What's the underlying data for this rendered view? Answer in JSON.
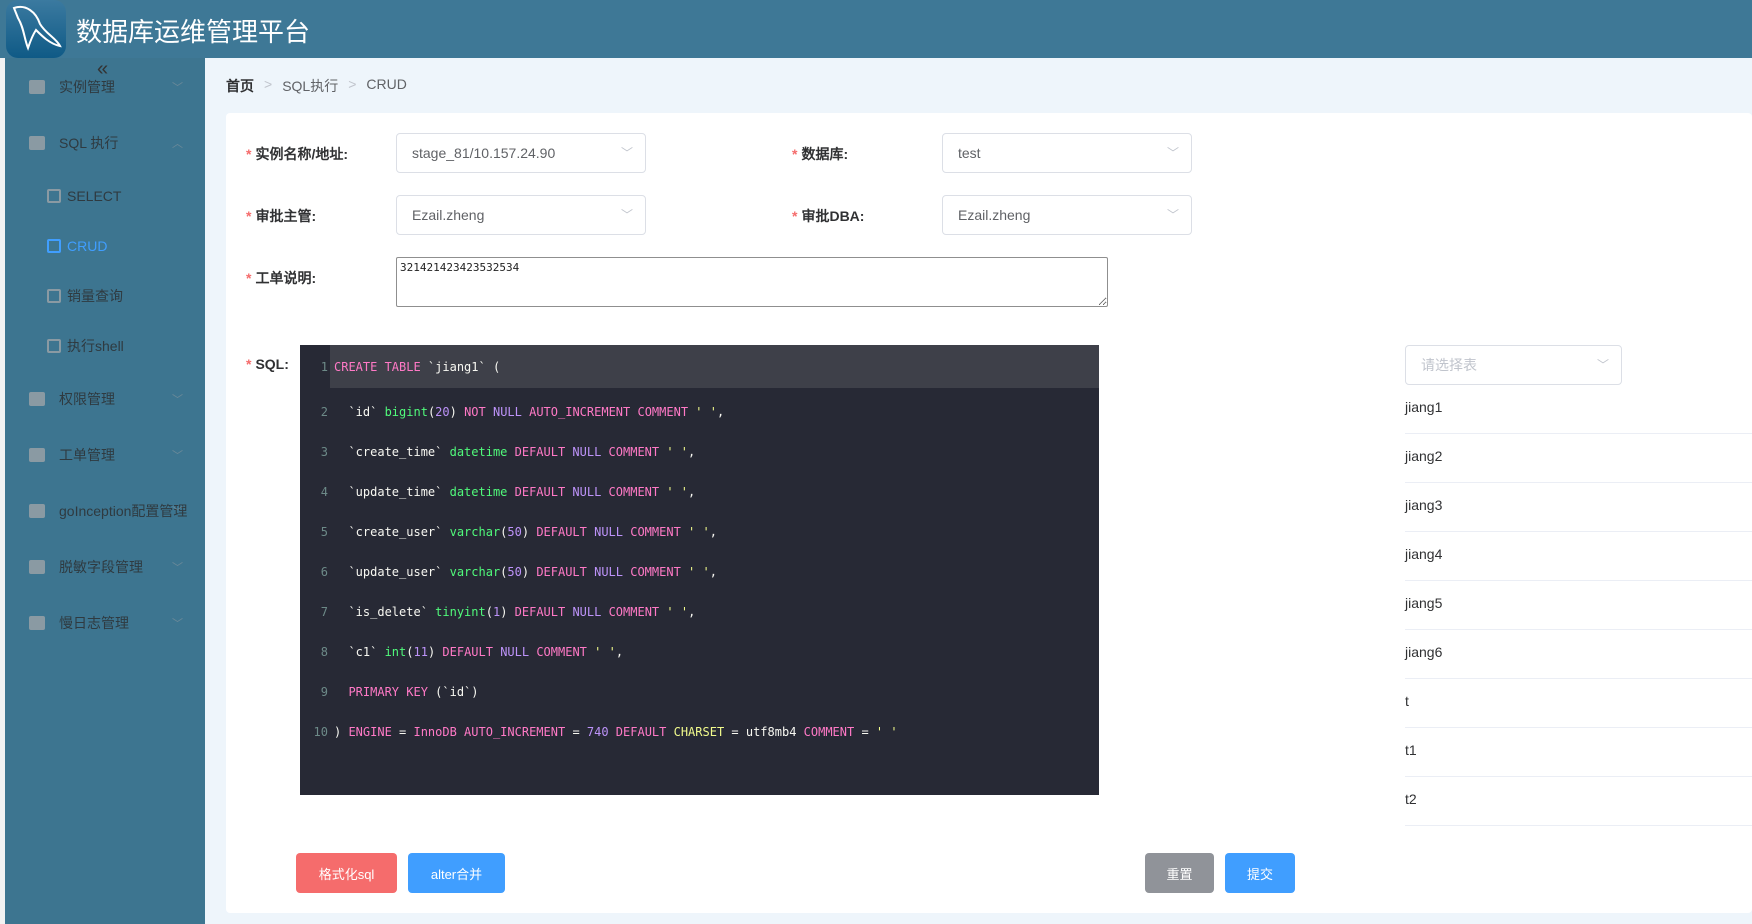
{
  "header": {
    "title": "数据库运维管理平台",
    "logo": "mysql-dolphin-logo"
  },
  "sidebar": {
    "collapse_icon": "double-chevron-left",
    "items": [
      {
        "label": "实例管理",
        "icon": "briefcase-icon",
        "chevron": "﹀"
      },
      {
        "label": "SQL 执行",
        "icon": "send-icon",
        "chevron": "︿"
      },
      {
        "label": "SELECT",
        "icon": "calendar-icon"
      },
      {
        "label": "CRUD",
        "icon": "doc-play-icon",
        "active": true
      },
      {
        "label": "销量查询",
        "icon": "doc-icon"
      },
      {
        "label": "执行shell",
        "icon": "doc-icon"
      },
      {
        "label": "权限管理",
        "icon": "user-box-icon",
        "chevron": "﹀"
      },
      {
        "label": "工单管理",
        "icon": "clipboard-icon",
        "chevron": "﹀"
      },
      {
        "label": "goInception配置管理",
        "icon": "briefcase-icon",
        "chevron": "﹀"
      },
      {
        "label": "脱敏字段管理",
        "icon": "briefcase-icon",
        "chevron": "﹀"
      },
      {
        "label": "慢日志管理",
        "icon": "briefcase-icon",
        "chevron": "﹀"
      }
    ]
  },
  "breadcrumb": [
    "首页",
    "SQL执行",
    "CRUD"
  ],
  "form": {
    "instance": {
      "label": "实例名称/地址:",
      "value": "stage_81/10.157.24.90"
    },
    "database": {
      "label": "数据库:",
      "value": "test"
    },
    "manager": {
      "label": "审批主管:",
      "value": "Ezail.zheng"
    },
    "dba": {
      "label": "审批DBA:",
      "value": "Ezail.zheng"
    },
    "desc": {
      "label": "工单说明:",
      "value": "321421423423532534"
    },
    "sql_label": "SQL:"
  },
  "sql_lines": [
    [
      [
        "CREATE TABLE",
        "kw"
      ],
      [
        " `jiang1` (",
        "tx"
      ]
    ],
    [
      [
        "  `id` ",
        "tx"
      ],
      [
        "bigint",
        "ty"
      ],
      [
        "(",
        "tx"
      ],
      [
        "20",
        "nu"
      ],
      [
        ") ",
        "tx"
      ],
      [
        "NOT ",
        "kw"
      ],
      [
        "NULL ",
        "nu"
      ],
      [
        "AUTO_INCREMENT COMMENT ",
        "kw"
      ],
      [
        "' '",
        "st"
      ],
      [
        ",",
        "tx"
      ]
    ],
    [
      [
        "  `create_time` ",
        "tx"
      ],
      [
        "datetime ",
        "ty"
      ],
      [
        "DEFAULT ",
        "kw"
      ],
      [
        "NULL ",
        "nu"
      ],
      [
        "COMMENT ",
        "kw"
      ],
      [
        "' '",
        "st"
      ],
      [
        ",",
        "tx"
      ]
    ],
    [
      [
        "  `update_time` ",
        "tx"
      ],
      [
        "datetime ",
        "ty"
      ],
      [
        "DEFAULT ",
        "kw"
      ],
      [
        "NULL ",
        "nu"
      ],
      [
        "COMMENT ",
        "kw"
      ],
      [
        "' '",
        "st"
      ],
      [
        ",",
        "tx"
      ]
    ],
    [
      [
        "  `create_user` ",
        "tx"
      ],
      [
        "varchar",
        "ty"
      ],
      [
        "(",
        "tx"
      ],
      [
        "50",
        "nu"
      ],
      [
        ") ",
        "tx"
      ],
      [
        "DEFAULT ",
        "kw"
      ],
      [
        "NULL ",
        "nu"
      ],
      [
        "COMMENT ",
        "kw"
      ],
      [
        "' '",
        "st"
      ],
      [
        ",",
        "tx"
      ]
    ],
    [
      [
        "  `update_user` ",
        "tx"
      ],
      [
        "varchar",
        "ty"
      ],
      [
        "(",
        "tx"
      ],
      [
        "50",
        "nu"
      ],
      [
        ") ",
        "tx"
      ],
      [
        "DEFAULT ",
        "kw"
      ],
      [
        "NULL ",
        "nu"
      ],
      [
        "COMMENT ",
        "kw"
      ],
      [
        "' '",
        "st"
      ],
      [
        ",",
        "tx"
      ]
    ],
    [
      [
        "  `is_delete` ",
        "tx"
      ],
      [
        "tinyint",
        "ty"
      ],
      [
        "(",
        "tx"
      ],
      [
        "1",
        "nu"
      ],
      [
        ") ",
        "tx"
      ],
      [
        "DEFAULT ",
        "kw"
      ],
      [
        "NULL ",
        "nu"
      ],
      [
        "COMMENT ",
        "kw"
      ],
      [
        "' '",
        "st"
      ],
      [
        ",",
        "tx"
      ]
    ],
    [
      [
        "  `c1` ",
        "tx"
      ],
      [
        "int",
        "ty"
      ],
      [
        "(",
        "tx"
      ],
      [
        "11",
        "nu"
      ],
      [
        ") ",
        "tx"
      ],
      [
        "DEFAULT ",
        "kw"
      ],
      [
        "NULL ",
        "nu"
      ],
      [
        "COMMENT ",
        "kw"
      ],
      [
        "' '",
        "st"
      ],
      [
        ",",
        "tx"
      ]
    ],
    [
      [
        "  PRIMARY KEY ",
        "kw"
      ],
      [
        "(`id`)",
        "tx"
      ]
    ],
    [
      [
        ") ",
        "tx"
      ],
      [
        "ENGINE ",
        "kw"
      ],
      [
        "= ",
        "tx"
      ],
      [
        "InnoDB AUTO_INCREMENT ",
        "kw"
      ],
      [
        "= ",
        "tx"
      ],
      [
        "740 ",
        "nu"
      ],
      [
        "DEFAULT ",
        "kw"
      ],
      [
        "CHARSET ",
        "st"
      ],
      [
        "= utf8mb4 ",
        "tx"
      ],
      [
        "COMMENT ",
        "kw"
      ],
      [
        "= ",
        "tx"
      ],
      [
        "' '",
        "st"
      ]
    ]
  ],
  "tables": {
    "placeholder": "请选择表",
    "items": [
      "jiang1",
      "jiang2",
      "jiang3",
      "jiang4",
      "jiang5",
      "jiang6",
      "t",
      "t1",
      "t2"
    ]
  },
  "buttons": {
    "format": "格式化sql",
    "alter": "alter合并",
    "reset": "重置",
    "submit": "提交"
  },
  "colors": {
    "header": "#3e7896",
    "sidebar": "#3d7590",
    "active": "#409eff",
    "danger": "#f56c6c",
    "info": "#909399",
    "editor_bg": "#272935"
  }
}
